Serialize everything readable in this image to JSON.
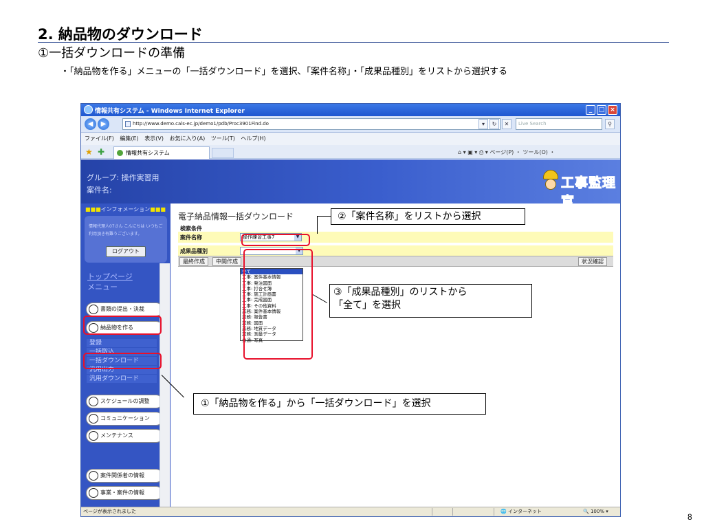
{
  "slide": {
    "title": "2. 納品物のダウンロード",
    "subtitle": "①一括ダウンロードの準備",
    "description": "・「納品物を作る」メニューの「一括ダウンロード」を選択、「案件名称」・「成果品種別」をリストから選択する",
    "page_number": "8"
  },
  "browser": {
    "window_title": "情報共有システム - Windows Internet Explorer",
    "url": "http://www.demo.cals-ec.jp/demo1/pdb/Proc3901Find.do",
    "search_placeholder": "Live Search",
    "menu": "ファイル(F)  編集(E)  表示(V)  お気に入り(A)  ツール(T)  ヘルプ(H)",
    "tab_title": "情報共有システム",
    "command_bar": "ページ(P) ・ ツール(O) ・",
    "status_text": "ページが表示されました",
    "zone": "インターネット",
    "zoom": "100%"
  },
  "app": {
    "group_label": "グループ: 操作実習用",
    "case_label": "案件名:",
    "logo_text": "工事監理官",
    "info_header": "インフォメーション",
    "welcome": "情報代理人07さん こんにちは いつもご利用頂き有難うございます。",
    "logout": "ログアウト",
    "top_link": "トップページ",
    "menu_label": "メニュー",
    "nav": {
      "documents": "書類の提出・決裁",
      "deliverables": "納品物を作る",
      "register": "登録",
      "bulk_import": "一括取込",
      "bulk_download": "一括ダウンロード",
      "general_output": "汎用出力",
      "general_download": "汎用ダウンロード",
      "schedule": "スケジュールの調整",
      "communication": "コミュニケーション",
      "maintenance": "メンテナンス",
      "stakeholders": "案件関係者の情報",
      "business": "事業・案件の情報"
    },
    "page_title": "電子納品情報一括ダウンロード",
    "search_conditions": "検索条件",
    "case_name_label": "案件名称",
    "case_name_value": "操作練習工事7",
    "deliverable_type_label": "成果品種別",
    "deliverable_type_value": "",
    "btn_final": "最終作成",
    "btn_interim": "中間作成",
    "btn_status": "状況確認",
    "dropdown_options": [
      "全て",
      "工事: 案件基本情報",
      "工事: 発注図面",
      "工事: 打合せ簿",
      "工事: 施工計画書",
      "工事: 完成図面",
      "工事: その他資料",
      "業務: 案件基本情報",
      "業務: 報告書",
      "業務: 図面",
      "業務: 地質データ",
      "業務: 測量データ",
      "共通: 写真"
    ]
  },
  "callouts": {
    "step1": "①「納品物を作る」から「一括ダウンロード」を選択",
    "step2": "②「案件名称」をリストから選択",
    "step3_line1": "③「成果品種別」のリストから",
    "step3_line2": "「全て」を選択"
  },
  "colors": {
    "highlight": "#e8102b",
    "sidebar": "#3455c3",
    "search_row": "#fefbb8"
  }
}
